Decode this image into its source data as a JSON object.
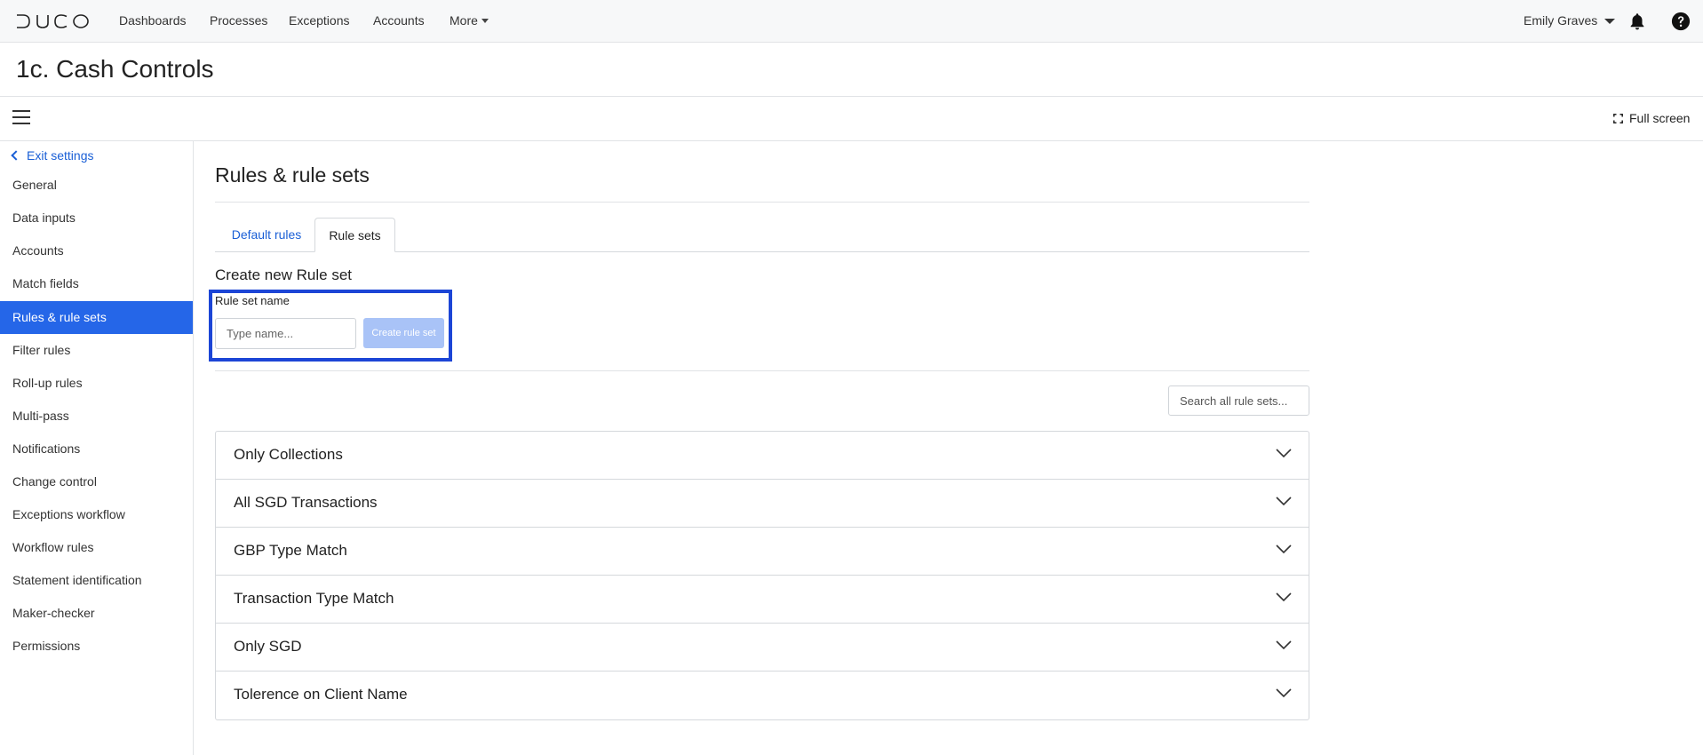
{
  "brand": {
    "logo_text": "DUCO"
  },
  "nav": {
    "items": [
      "Dashboards",
      "Processes",
      "Exceptions",
      "Accounts"
    ],
    "more_label": "More",
    "user_name": "Emily Graves"
  },
  "page": {
    "title": "1c. Cash Controls"
  },
  "toolbar": {
    "fullscreen_label": "Full screen"
  },
  "sidebar": {
    "exit_label": "Exit settings",
    "items": [
      {
        "label": "General"
      },
      {
        "label": "Data inputs"
      },
      {
        "label": "Accounts"
      },
      {
        "label": "Match fields"
      },
      {
        "label": "Rules & rule sets",
        "active": true
      },
      {
        "label": "Filter rules"
      },
      {
        "label": "Roll-up rules"
      },
      {
        "label": "Multi-pass"
      },
      {
        "label": "Notifications"
      },
      {
        "label": "Change control"
      },
      {
        "label": "Exceptions workflow"
      },
      {
        "label": "Workflow rules"
      },
      {
        "label": "Statement identification"
      },
      {
        "label": "Maker-checker"
      },
      {
        "label": "Permissions"
      }
    ]
  },
  "main": {
    "heading": "Rules & rule sets",
    "tabs": [
      {
        "label": "Default rules"
      },
      {
        "label": "Rule sets",
        "active": true
      }
    ],
    "create": {
      "heading": "Create new Rule set",
      "field_label": "Rule set name",
      "placeholder": "Type name...",
      "value": "",
      "button_label": "Create rule set"
    },
    "search": {
      "placeholder": "Search all rule sets..."
    },
    "rule_sets": [
      {
        "name": "Only Collections"
      },
      {
        "name": "All SGD Transactions"
      },
      {
        "name": "GBP Type Match"
      },
      {
        "name": "Transaction Type Match"
      },
      {
        "name": "Only SGD"
      },
      {
        "name": "Tolerence on Client Name"
      }
    ]
  },
  "colors": {
    "accent": "#2566e8",
    "link": "#1a5fd6",
    "highlight_border": "#1c45d6",
    "disabled_button": "#a9c3f7"
  },
  "icons": [
    "duco-logo",
    "chevron-left-icon",
    "caret-down-icon",
    "bell-icon",
    "help-icon",
    "hamburger-icon",
    "fullscreen-icon",
    "chevron-down-icon"
  ]
}
